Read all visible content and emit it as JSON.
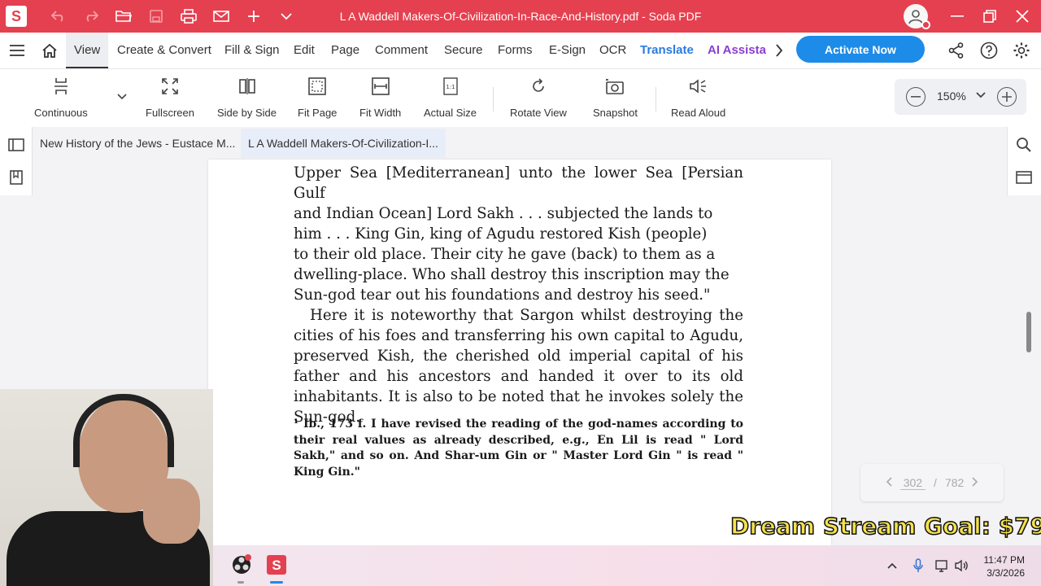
{
  "window": {
    "title": "L A Waddell Makers-Of-Civilization-In-Race-And-History.pdf   -   Soda PDF",
    "app_logo": "S",
    "quick_access": [
      "undo-icon",
      "redo-icon",
      "open-folder-icon",
      "save-icon",
      "print-icon",
      "mail-icon",
      "plus-icon",
      "chevron-down-icon"
    ],
    "brand_color": "#e5404f"
  },
  "menu": {
    "items": [
      "View",
      "Create & Convert",
      "Fill & Sign",
      "Edit",
      "Page",
      "Comment",
      "Secure",
      "Forms",
      "E-Sign",
      "OCR",
      "Translate",
      "AI Assistant"
    ],
    "active": "View",
    "activate_label": "Activate Now"
  },
  "toolbar": {
    "continuous": "Continuous",
    "fullscreen": "Fullscreen",
    "side_by_side": "Side by Side",
    "fit_page": "Fit Page",
    "fit_width": "Fit Width",
    "actual_size": "Actual Size",
    "rotate_view": "Rotate View",
    "snapshot": "Snapshot",
    "read_aloud": "Read Aloud",
    "zoom": "150%"
  },
  "tabs": [
    {
      "label": "New History of the Jews - Eustace M..."
    },
    {
      "label": "L A Waddell Makers-Of-Civilization-I..."
    }
  ],
  "document": {
    "lines": [
      "Upper Sea [Mediterranean] unto the lower Sea [Persian Gulf",
      "and Indian Ocean] Lord Sakh . . . subjected the lands to",
      "him . . . King Gin, king of Agudu restored Kish (people)",
      "to their old place.  Their city he gave (back) to them as a",
      "dwelling-place.  Who shall destroy this inscription may the",
      "Sun-god tear out his foundations and destroy his seed.\""
    ],
    "paragraph2": "Here it is noteworthy that Sargon whilst destroying the cities of his foes and transferring his own capital to Agudu, preserved Kish, the cherished old imperial capital of his father and his ancestors and handed it over to its old inhabitants.  It is also to be noted that he invokes solely the Sun-god.",
    "footnote": "¹ Ib., 173 f.  I have revised the reading of the god-names according to their real values as already described, e.g., En Lil is read \" Lord Sakh,\" and so on.  And Shar-um Gin or \" Master Lord Gin \" is read \" King Gin.\""
  },
  "page_nav": {
    "current": "302",
    "separator": "/",
    "total": "782"
  },
  "overlay": {
    "goal_text": "Dream Stream Goal: $79"
  },
  "taskbar": {
    "time": "11:47 PM",
    "date": "3/3/2026"
  }
}
